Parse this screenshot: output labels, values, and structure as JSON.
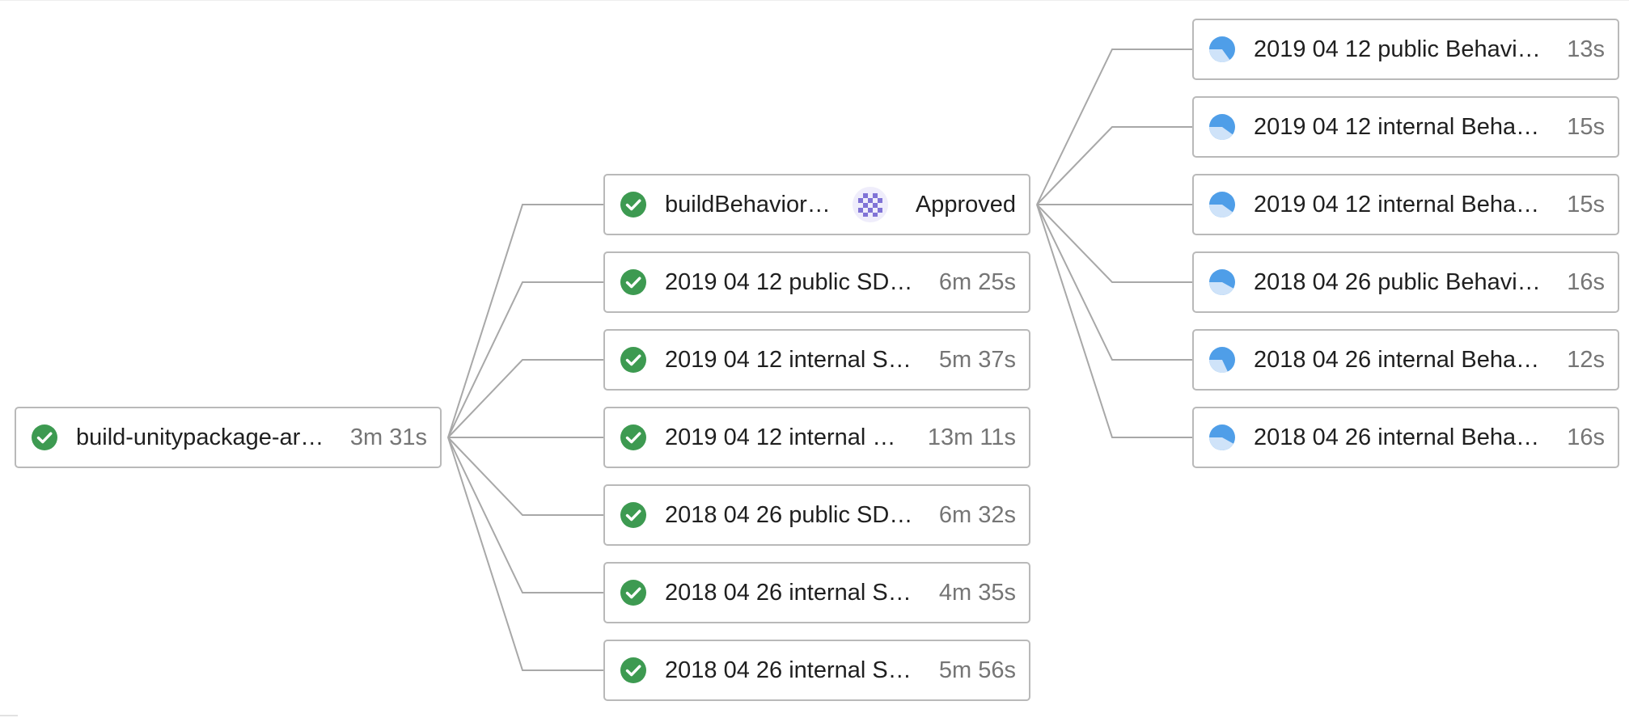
{
  "colors": {
    "success": "#3d9a51",
    "running": "#4f9ee8",
    "running_light": "#cfe3f9",
    "border": "#b9b9b9",
    "connector": "#a8a8a8",
    "text": "#1f1f1f",
    "muted": "#757575",
    "avatar": "#8073d6"
  },
  "root": {
    "name": "build-unitypackage-ar…",
    "duration": "3m 31s",
    "status": "success",
    "icon": "check-circle-icon"
  },
  "stage2": [
    {
      "name": "buildBehavior…",
      "status": "success",
      "icon": "check-circle-icon",
      "avatar_icon": "identicon-avatar-icon",
      "approval": "Approved"
    },
    {
      "name": "2019 04 12 public SD…",
      "duration": "6m 25s",
      "status": "success",
      "icon": "check-circle-icon"
    },
    {
      "name": "2019 04 12 internal S…",
      "duration": "5m 37s",
      "status": "success",
      "icon": "check-circle-icon"
    },
    {
      "name": "2019 04 12 internal …",
      "duration": "13m 11s",
      "status": "success",
      "icon": "check-circle-icon"
    },
    {
      "name": "2018 04 26 public SD…",
      "duration": "6m 32s",
      "status": "success",
      "icon": "check-circle-icon"
    },
    {
      "name": "2018 04 26 internal S…",
      "duration": "4m 35s",
      "status": "success",
      "icon": "check-circle-icon"
    },
    {
      "name": "2018 04 26 internal S…",
      "duration": "5m 56s",
      "status": "success",
      "icon": "check-circle-icon"
    }
  ],
  "stage3": [
    {
      "name": "2019 04 12 public Behavi…",
      "duration": "13s",
      "status": "running",
      "progress": 0.35,
      "icon": "running-pie-icon"
    },
    {
      "name": "2019 04 12 internal Beha…",
      "duration": "15s",
      "status": "running",
      "progress": 0.4,
      "icon": "running-pie-icon"
    },
    {
      "name": "2019 04 12 internal Beha…",
      "duration": "15s",
      "status": "running",
      "progress": 0.4,
      "icon": "running-pie-icon"
    },
    {
      "name": "2018 04 26 public Behavi…",
      "duration": "16s",
      "status": "running",
      "progress": 0.42,
      "icon": "running-pie-icon"
    },
    {
      "name": "2018 04 26 internal Beha…",
      "duration": "12s",
      "status": "running",
      "progress": 0.32,
      "icon": "running-pie-icon"
    },
    {
      "name": "2018 04 26 internal Beha…",
      "duration": "16s",
      "status": "running",
      "progress": 0.42,
      "icon": "running-pie-icon"
    }
  ]
}
